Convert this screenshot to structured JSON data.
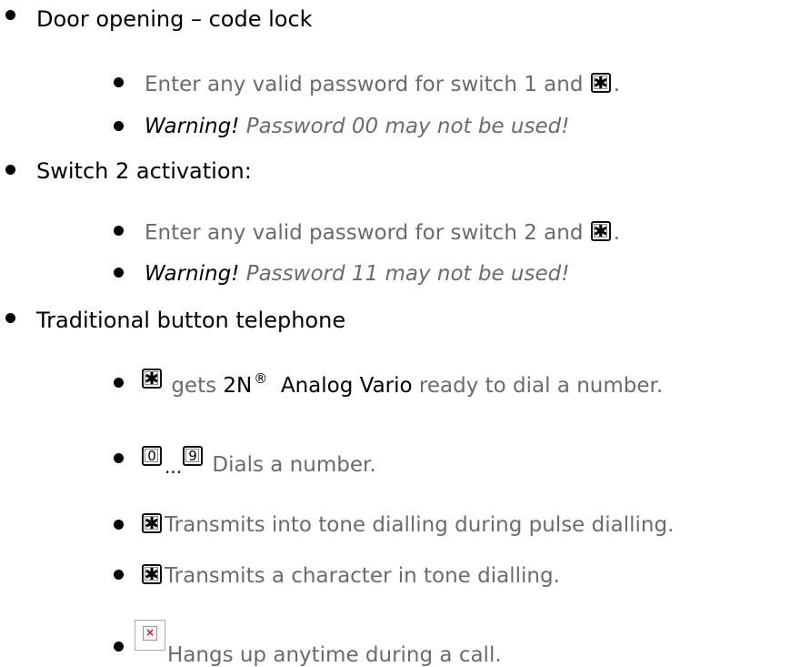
{
  "sections": [
    {
      "title": "Door opening – code lock",
      "items": [
        {
          "text": "Enter any valid password for switch 1 and",
          "suffix": ".",
          "key": "star-key-icon"
        },
        {
          "warning_label": "Warning!",
          "warning_text": "Password 00 may not be used!"
        }
      ]
    },
    {
      "title": "Switch 2 activation:",
      "items": [
        {
          "text": "Enter any valid password for switch 2 and",
          "suffix": ".",
          "key": "star-key-icon"
        },
        {
          "warning_label": "Warning!",
          "warning_text": "Password 11 may not be used!"
        }
      ]
    },
    {
      "title": "Traditional button telephone",
      "items": [
        {
          "key": "star-key-icon",
          "pre": "gets",
          "product": "2N",
          "reg": "®",
          "product2": "Analog Vario",
          "text": "ready to dial a number."
        },
        {
          "key_from": "0",
          "key_to": "9",
          "dots": "...",
          "text": "Dials a number."
        },
        {
          "key": "star-key-icon",
          "text": "Transmits into tone dialling during pulse dialling."
        },
        {
          "key": "star-key-icon",
          "text": "Transmits a character in tone dialling."
        },
        {
          "key": "hangup-icon",
          "hang_glyph": "×",
          "text": "Hangs up anytime during a call."
        }
      ]
    }
  ],
  "icons": {
    "star_glyph": "✱"
  }
}
